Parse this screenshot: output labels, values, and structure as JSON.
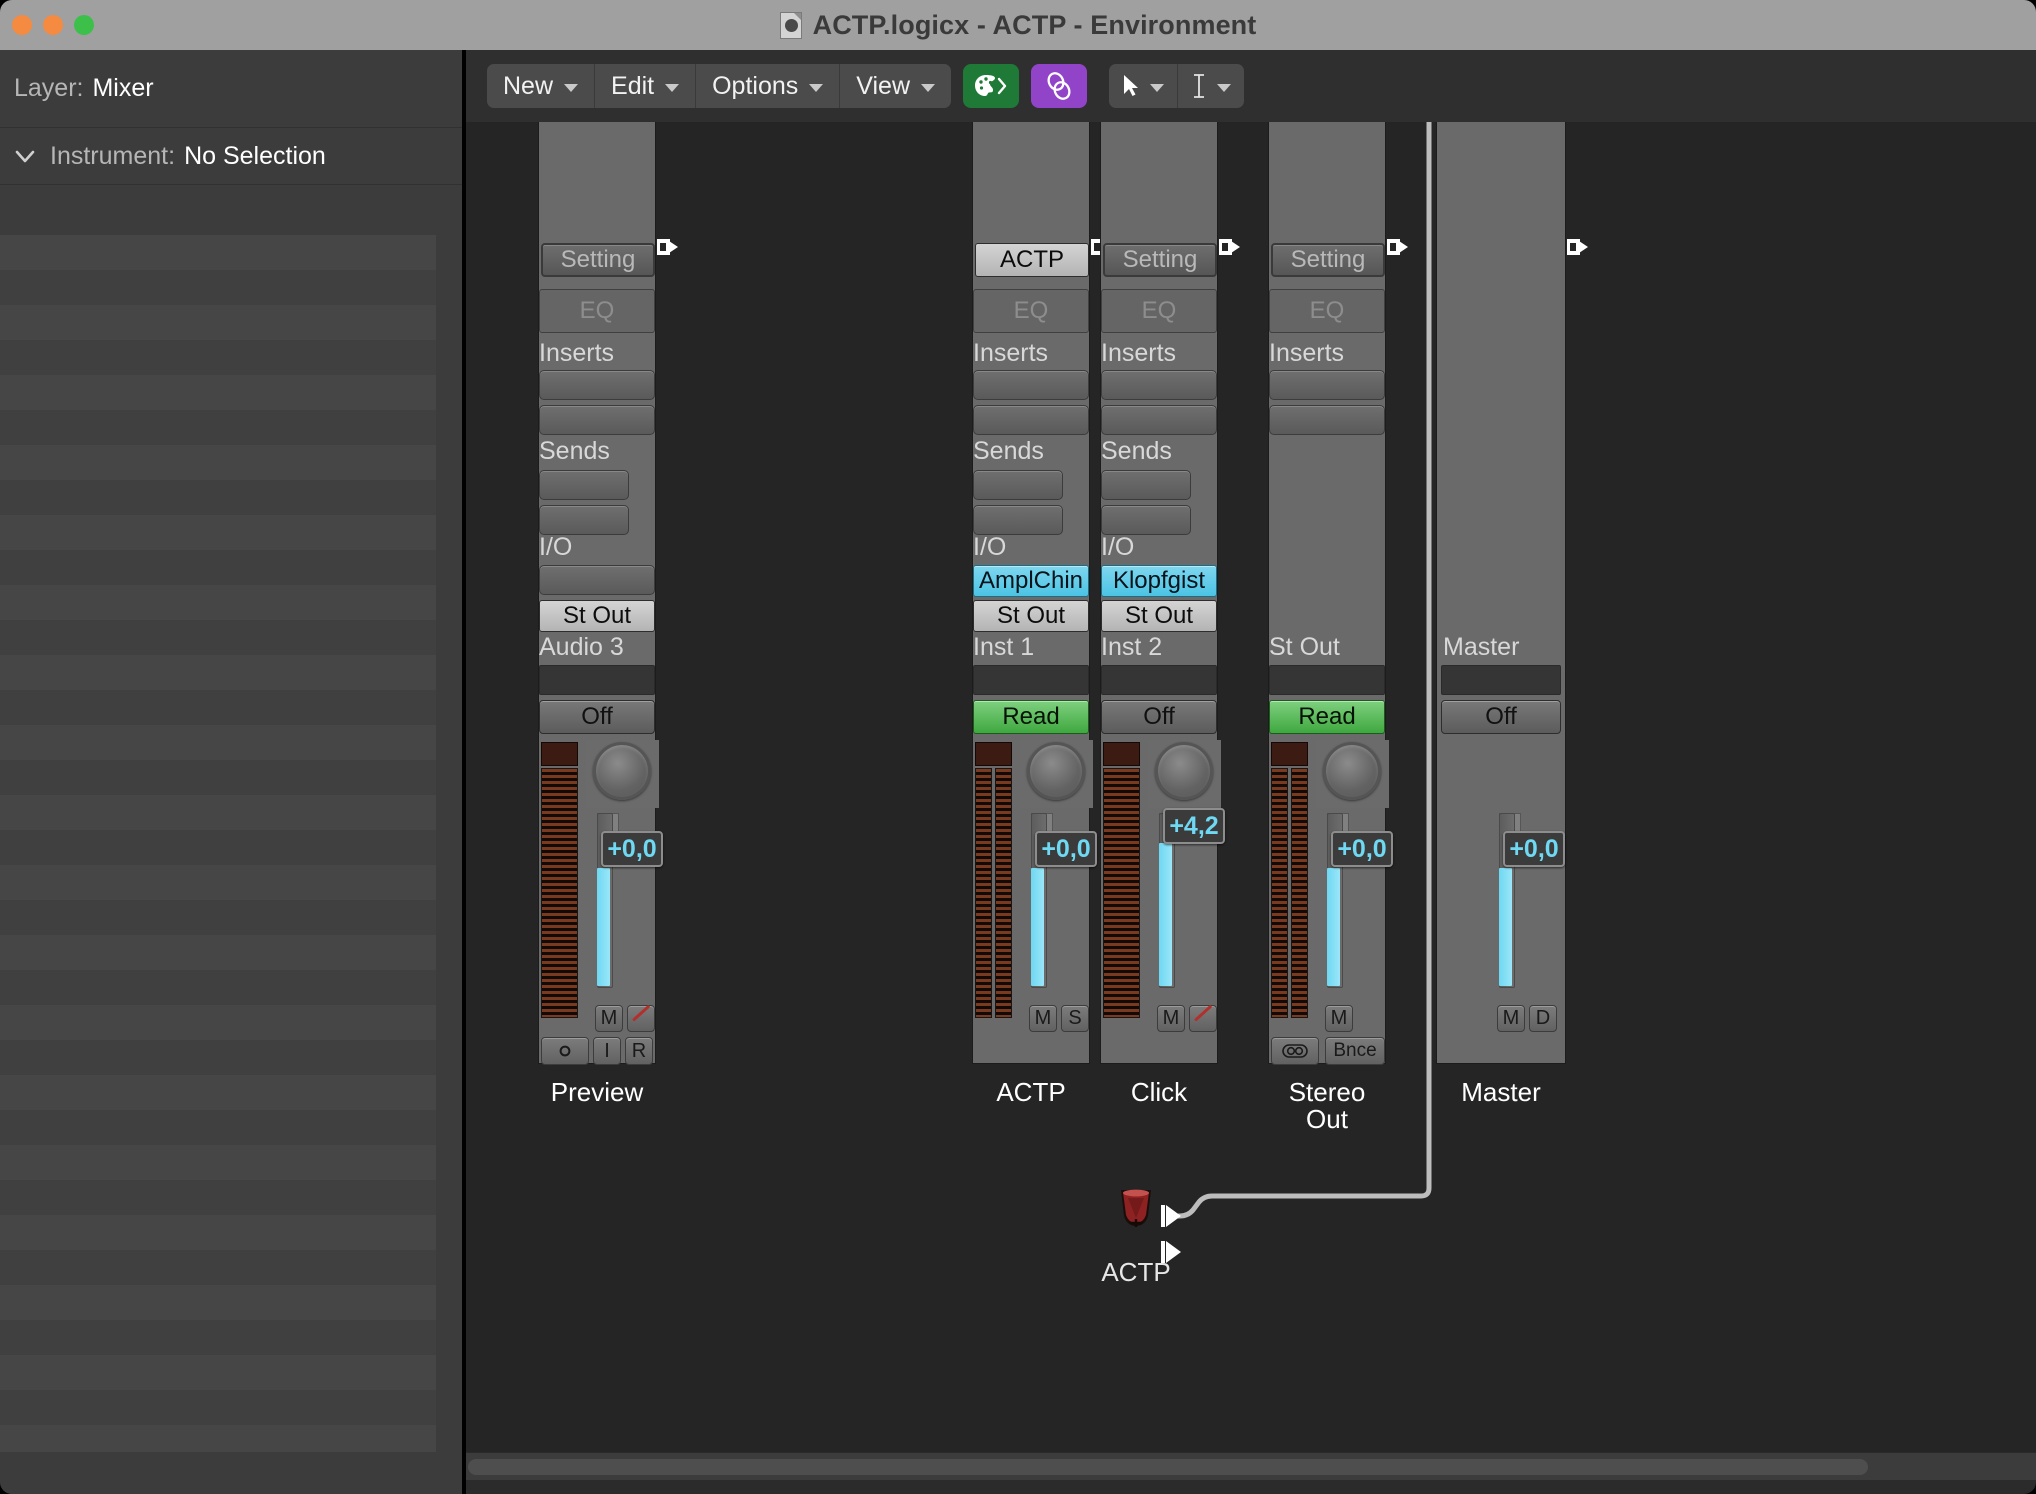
{
  "window": {
    "title": "ACTP.logicx - ACTP - Environment",
    "doc_icon": "logic-document-icon",
    "traffic_lights": [
      "close-button",
      "minimize-button",
      "zoom-button"
    ]
  },
  "sidebar": {
    "layer_label": "Layer:",
    "layer_value": "Mixer",
    "instrument_label": "Instrument:",
    "instrument_value": "No Selection",
    "disclosure_icon": "chevron-down-icon"
  },
  "toolbar": {
    "menus": [
      {
        "label": "New",
        "icon": "chevron-down-icon"
      },
      {
        "label": "Edit",
        "icon": "chevron-down-icon"
      },
      {
        "label": "Options",
        "icon": "chevron-down-icon"
      },
      {
        "label": "View",
        "icon": "chevron-down-icon"
      }
    ],
    "color_button": {
      "icon": "color-palette-icon",
      "color": "#1f7a38"
    },
    "link_button": {
      "icon": "link-chain-icon",
      "color": "#9244c9"
    },
    "tools": [
      {
        "icon": "pointer-arrow-icon",
        "caret": "chevron-down-icon"
      },
      {
        "icon": "text-cursor-icon",
        "caret": "chevron-down-icon"
      }
    ]
  },
  "colors": {
    "accent_cyan": "#4cc3e4",
    "accent_green": "#3fa83f",
    "fader_blue": "#6fd8f2",
    "strip_bg": "#6a6a6a",
    "canvas_bg": "#252525",
    "titlebar": "#a0a0a0"
  },
  "canvas": {
    "strips": [
      {
        "name": "Preview",
        "top_button": "Setting",
        "top_button_style": "setting",
        "eq": "EQ",
        "inserts_label": "Inserts",
        "insert_slots": 2,
        "sends_label": "Sends",
        "send_slots": 2,
        "io_label": "I/O",
        "input": "",
        "input_style": "blank",
        "output": "St Out",
        "channel_label": "Audio 3",
        "automation": "Off",
        "automation_style": "off",
        "fader_value": "+0,0",
        "meter_channels": 1,
        "buttons_row1": [
          "M",
          "rec"
        ],
        "buttons_row2": [
          "O",
          "I",
          "R"
        ],
        "port_marker": "output-port-icon"
      },
      {
        "name": "ACTP",
        "top_button": "ACTP",
        "top_button_style": "light",
        "eq": "EQ",
        "inserts_label": "Inserts",
        "insert_slots": 2,
        "sends_label": "Sends",
        "send_slots": 2,
        "io_label": "I/O",
        "input": "AmplChin",
        "input_style": "cyan",
        "output": "St Out",
        "channel_label": "Inst 1",
        "automation": "Read",
        "automation_style": "read",
        "fader_value": "+0,0",
        "meter_channels": 2,
        "buttons_row1": [
          "M",
          "S"
        ],
        "buttons_row2": [],
        "port_marker": "output-port-icon"
      },
      {
        "name": "Click",
        "top_button": "Setting",
        "top_button_style": "setting",
        "eq": "EQ",
        "inserts_label": "Inserts",
        "insert_slots": 2,
        "sends_label": "Sends",
        "send_slots": 2,
        "io_label": "I/O",
        "input": "Klopfgist",
        "input_style": "cyan",
        "output": "St Out",
        "channel_label": "Inst 2",
        "automation": "Off",
        "automation_style": "off",
        "fader_value": "+4,2",
        "meter_channels": 1,
        "buttons_row1": [
          "M",
          "rec"
        ],
        "buttons_row2": [],
        "port_marker": "output-port-icon"
      },
      {
        "name": "Stereo Out",
        "name_line1": "Stereo",
        "name_line2": "Out",
        "top_button": "Setting",
        "top_button_style": "setting",
        "eq": "EQ",
        "inserts_label": "Inserts",
        "insert_slots": 2,
        "sends_label": "",
        "send_slots": 0,
        "io_label": "",
        "input": "",
        "input_style": "none",
        "output": "",
        "channel_label": "St Out",
        "automation": "Read",
        "automation_style": "read",
        "fader_value": "+0,0",
        "meter_channels": 2,
        "buttons_row1": [
          "M"
        ],
        "buttons_row2": [
          "stereo",
          "Bnce"
        ],
        "port_marker": "output-port-icon"
      },
      {
        "name": "Master",
        "top_button": "",
        "top_button_style": "none",
        "eq": "",
        "inserts_label": "",
        "insert_slots": 0,
        "sends_label": "",
        "send_slots": 0,
        "io_label": "",
        "input": "",
        "input_style": "none",
        "output": "",
        "channel_label": "Master",
        "automation": "Off",
        "automation_style": "off",
        "fader_value": "+0,0",
        "meter_channels": 0,
        "buttons_row1": [
          "M",
          "D"
        ],
        "buttons_row2": [],
        "port_marker": "output-port-icon"
      }
    ],
    "instrument_object": {
      "label": "ACTP",
      "icon": "conga-drums-icon",
      "ports": [
        "output-port-1",
        "output-port-2"
      ],
      "cable_to": "ACTP channel strip"
    }
  }
}
